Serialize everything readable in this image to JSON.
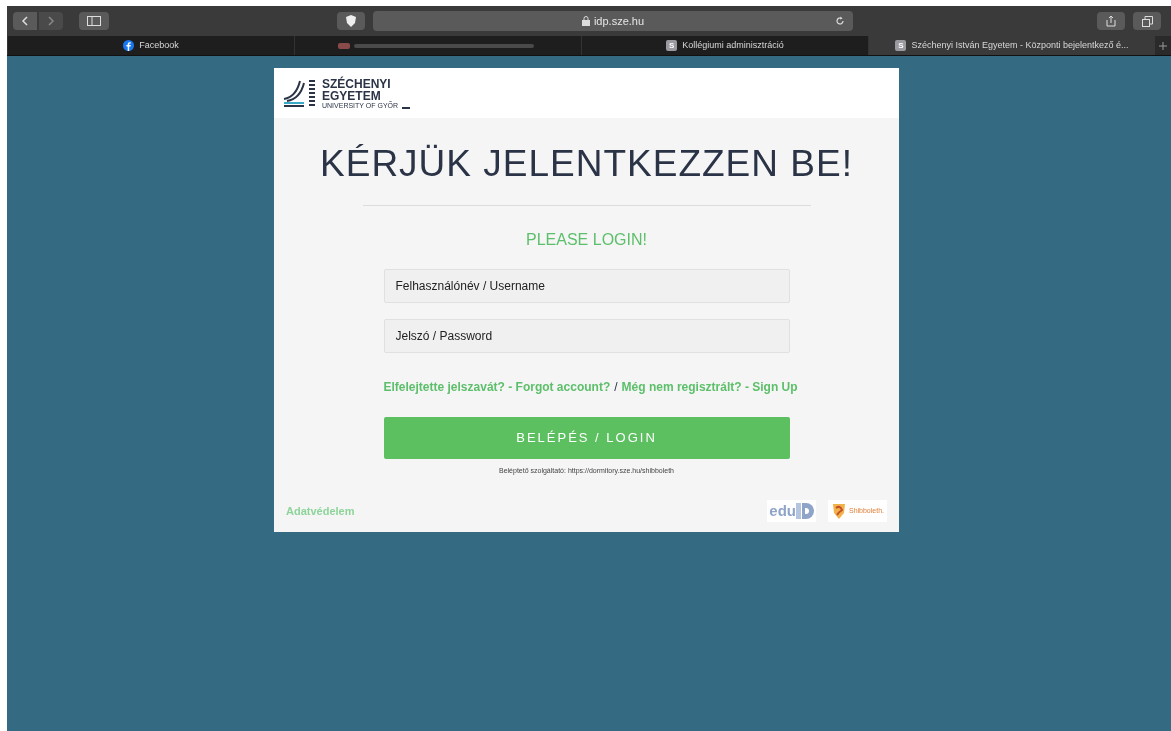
{
  "browser": {
    "url": "idp.sze.hu",
    "tabs": [
      {
        "kind": "facebook",
        "label": "Facebook",
        "selected": false
      },
      {
        "kind": "blurred",
        "selected": false
      },
      {
        "kind": "site",
        "badge": "S",
        "label": "Kollégiumi adminisztráció",
        "selected": false
      },
      {
        "kind": "site",
        "badge": "S",
        "label": "Széchenyi István Egyetem - Központi bejelentkező é...",
        "selected": true
      }
    ]
  },
  "logo": {
    "line_1": "SZÉCHENYI",
    "line_2": "EGYETEM",
    "line_3": "UNIVERSITY OF GYŐR"
  },
  "heading": "KÉRJÜK JELENTKEZZEN BE!",
  "subheading": "PLEASE LOGIN!",
  "fields": [
    {
      "placeholder": "Felhasználónév / Username"
    },
    {
      "placeholder": "Jelszó / Password"
    }
  ],
  "links": [
    {
      "label": "Elfelejtette jelszavát? - Forgot account?"
    },
    {
      "label": "Még nem regisztrált? - Sign Up"
    }
  ],
  "links_separator": "/",
  "login_button": "BELÉPÉS / LOGIN",
  "service_note": "Beléptető szolgáltató: https://dormitory.sze.hu/shibboleth",
  "footer": {
    "privacy_link": "Adatvédelem",
    "eduid_text": "edu",
    "shibboleth_text": "Shibboleth."
  }
}
